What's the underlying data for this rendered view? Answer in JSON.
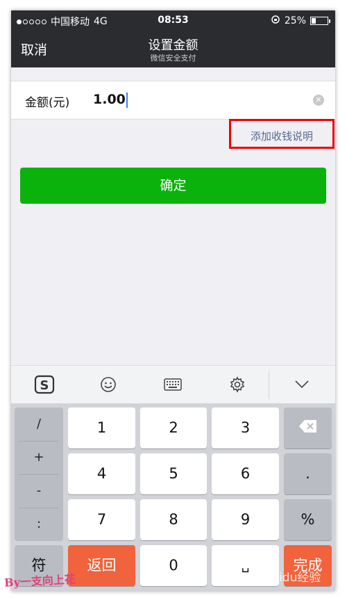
{
  "status": {
    "carrier": "中国移动",
    "network": "4G",
    "time": "08:53",
    "battery": "25%"
  },
  "nav": {
    "cancel": "取消",
    "title": "设置金额",
    "subtitle": "微信安全支付"
  },
  "amount": {
    "label": "金额(元)",
    "value": "1.00"
  },
  "add_note_link": "添加收钱说明",
  "confirm_button": "确定",
  "keyboard": {
    "symbols": [
      "/",
      "+",
      "-",
      ":"
    ],
    "symbol_key": "符",
    "digits": [
      "1",
      "2",
      "3",
      "4",
      "5",
      "6",
      "7",
      "8",
      "9"
    ],
    "zero": "0",
    "dot": ".",
    "percent": "%",
    "back": "返回",
    "done": "完成",
    "space": "␣"
  },
  "watermark": {
    "left": "By一支向上花",
    "right": "Baidu经验"
  },
  "colors": {
    "nav_bg": "#2b2c30",
    "confirm_green": "#0bb20c",
    "highlight_red": "#f20000",
    "link": "#57698e",
    "orange": "#f0633c"
  }
}
